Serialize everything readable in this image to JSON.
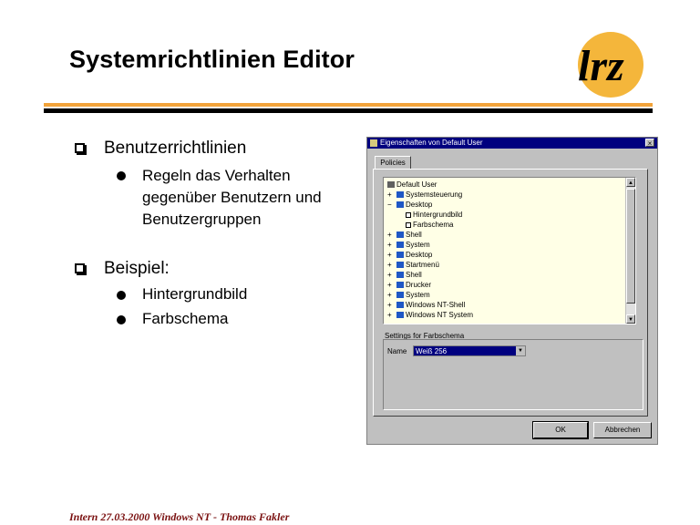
{
  "slide": {
    "title": "Systemrichtlinien Editor",
    "footer": "Intern 27.03.2000 Windows NT - Thomas Fakler",
    "logo_text": "lrz",
    "colors": {
      "accent": "#f2a33a",
      "rule": "#000000",
      "footer": "#7a1010",
      "logo_circle": "#f4b63b"
    }
  },
  "bullets": [
    {
      "text": "Benutzerrichtlinien",
      "sub": [
        "Regeln das Verhalten",
        "gegenüber Benutzern und",
        "Benutzergruppen"
      ]
    },
    {
      "text": "Beispiel:",
      "sub": [
        "Hintergrundbild",
        "Farbschema"
      ]
    }
  ],
  "dialog": {
    "title": "Eigenschaften von Default User",
    "close": "×",
    "tab": "Policies",
    "tree": [
      {
        "label": "Default User",
        "icon": "root-icon",
        "level": 0,
        "expander": ""
      },
      {
        "label": "Systemsteuerung",
        "icon": "book-icon",
        "level": 1,
        "expander": "+"
      },
      {
        "label": "Desktop",
        "icon": "book-icon",
        "level": 1,
        "expander": "−"
      },
      {
        "label": "Hintergrundbild",
        "icon": "checkbox-icon",
        "level": 2,
        "expander": ""
      },
      {
        "label": "Farbschema",
        "icon": "checkbox-icon",
        "level": 2,
        "expander": ""
      },
      {
        "label": "Shell",
        "icon": "book-icon",
        "level": 1,
        "expander": "+"
      },
      {
        "label": "System",
        "icon": "book-icon",
        "level": 1,
        "expander": "+"
      },
      {
        "label": "Desktop",
        "icon": "book-icon",
        "level": 1,
        "expander": "+"
      },
      {
        "label": "Startmenü",
        "icon": "book-icon",
        "level": 1,
        "expander": "+"
      },
      {
        "label": "Shell",
        "icon": "book-icon",
        "level": 1,
        "expander": "+"
      },
      {
        "label": "Drucker",
        "icon": "book-icon",
        "level": 1,
        "expander": "+"
      },
      {
        "label": "System",
        "icon": "book-icon",
        "level": 1,
        "expander": "+"
      },
      {
        "label": "Windows NT-Shell",
        "icon": "book-icon",
        "level": 1,
        "expander": "+"
      },
      {
        "label": "Windows NT System",
        "icon": "book-icon",
        "level": 1,
        "expander": "+"
      }
    ],
    "settings_label": "Settings for Farbschema",
    "name_label": "Name",
    "name_value": "Weiß 256",
    "ok": "OK",
    "cancel": "Abbrechen"
  }
}
